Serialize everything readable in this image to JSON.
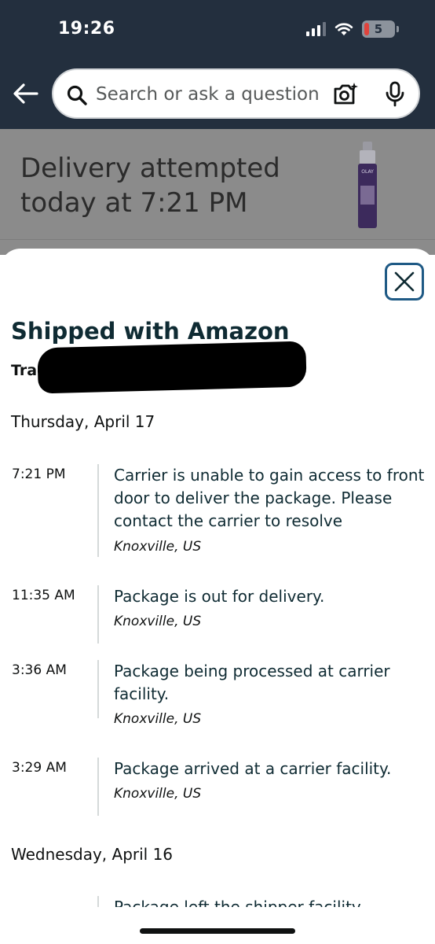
{
  "status_bar": {
    "time": "19:26",
    "battery": "5"
  },
  "search": {
    "placeholder": "Search or ask a question"
  },
  "underlay": {
    "delivery_status": "Delivery attempted today at 7:21 PM",
    "product_brand": "OLAY"
  },
  "sheet": {
    "title": "Shipped with Amazon",
    "tracking_label": "Tracki",
    "days": [
      {
        "date": "Thursday, April 17",
        "events": [
          {
            "time": "7:21 PM",
            "description": "Carrier is unable to gain access to front door to deliver the package. Please contact the carrier to resolve",
            "location": "Knoxville, US"
          },
          {
            "time": "11:35 AM",
            "description": "Package is out for delivery.",
            "location": "Knoxville, US"
          },
          {
            "time": "3:36 AM",
            "description": "Package being processed at carrier facility.",
            "location": "Knoxville, US"
          },
          {
            "time": "3:29 AM",
            "description": "Package arrived at a carrier facility.",
            "location": "Knoxville, US"
          }
        ]
      },
      {
        "date": "Wednesday, April 16",
        "events": [
          {
            "time": "",
            "description": "Package left the shipper facility.",
            "location": ""
          }
        ]
      }
    ]
  },
  "colors": {
    "header_bg": "#232f3e",
    "close_border": "#1f5a85",
    "title_text": "#0f2b33"
  },
  "icons": {
    "back": "arrow-left-icon",
    "search": "search-icon",
    "camera": "camera-icon",
    "mic": "microphone-icon",
    "close": "close-icon"
  }
}
